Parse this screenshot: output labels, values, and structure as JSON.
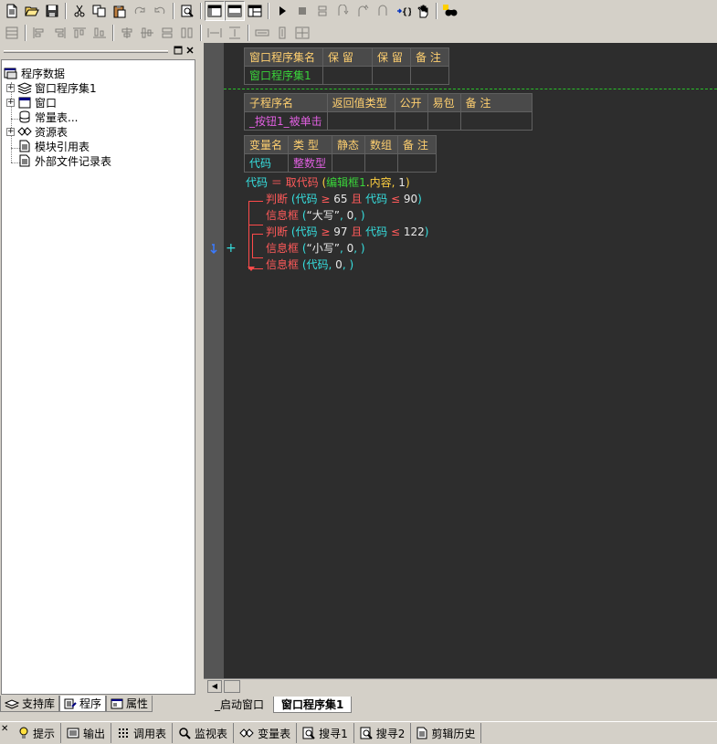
{
  "left_panel": {
    "tree": [
      {
        "label": "程序数据",
        "icon": "program-data-icon"
      },
      {
        "label": "窗口程序集1",
        "icon": "layers-icon"
      },
      {
        "label": "窗口",
        "icon": "window-icon"
      },
      {
        "label": "常量表...",
        "icon": "database-icon"
      },
      {
        "label": "资源表",
        "icon": "resource-icon"
      },
      {
        "label": "模块引用表",
        "icon": "document-icon"
      },
      {
        "label": "外部文件记录表",
        "icon": "document-icon"
      }
    ],
    "tabs": [
      {
        "label": "支持库",
        "icon": "library-icon"
      },
      {
        "label": "程序",
        "icon": "program-icon"
      },
      {
        "label": "属性",
        "icon": "property-icon"
      }
    ]
  },
  "editor": {
    "assembly_table": {
      "headers": [
        "窗口程序集名",
        "保 留",
        "保 留",
        "备 注"
      ],
      "row": [
        "窗口程序集1",
        "",
        "",
        ""
      ]
    },
    "sub_table": {
      "headers": [
        "子程序名",
        "返回值类型",
        "公开",
        "易包",
        "备 注"
      ],
      "row": [
        "_按钮1_被单击",
        "",
        "",
        "",
        ""
      ]
    },
    "var_table": {
      "headers": [
        "变量名",
        "类 型",
        "静态",
        "数组",
        "备 注"
      ],
      "row": [
        "代码",
        "整数型",
        "",
        "",
        ""
      ]
    },
    "code": {
      "l1": {
        "a": "代码",
        "b": " ＝ ",
        "c": "取代码",
        "d": " (",
        "e": "编辑框1",
        "f": ".",
        "g": "内容",
        "h": ", ",
        "i": "1",
        "j": ")"
      },
      "l2": {
        "a": "判断",
        "b": " (",
        "c": "代码",
        "d": " ≥ ",
        "e": "65",
        "f": " 且 ",
        "g": "代码",
        "h": " ≤ ",
        "i": "90",
        "j": ")"
      },
      "l3": {
        "a": "信息框",
        "b": " (",
        "c": "“大写”",
        "d": ", ",
        "e": "0",
        "f": ", ",
        "g": ")"
      },
      "l4": {
        "a": "判断",
        "b": " (",
        "c": "代码",
        "d": " ≥ ",
        "e": "97",
        "f": " 且 ",
        "g": "代码",
        "h": " ≤ ",
        "i": "122",
        "j": ")"
      },
      "l5": {
        "a": "信息框",
        "b": " (",
        "c": "“小写”",
        "d": ", ",
        "e": "0",
        "f": ", ",
        "g": ")"
      },
      "l6": {
        "a": "信息框",
        "b": " (",
        "c": "代码",
        "d": ", ",
        "e": "0",
        "f": ", ",
        "g": ")"
      }
    },
    "gutter_marker": "+",
    "tabs": [
      "_启动窗口",
      "窗口程序集1"
    ]
  },
  "bottom_bar": [
    {
      "label": "提示",
      "icon": "hint-icon"
    },
    {
      "label": "输出",
      "icon": "output-icon"
    },
    {
      "label": "调用表",
      "icon": "call-table-icon"
    },
    {
      "label": "监视表",
      "icon": "watch-icon"
    },
    {
      "label": "变量表",
      "icon": "variable-icon"
    },
    {
      "label": "搜寻1",
      "icon": "search-icon"
    },
    {
      "label": "搜寻2",
      "icon": "search-icon"
    },
    {
      "label": "剪辑历史",
      "icon": "clipboard-history-icon"
    }
  ]
}
